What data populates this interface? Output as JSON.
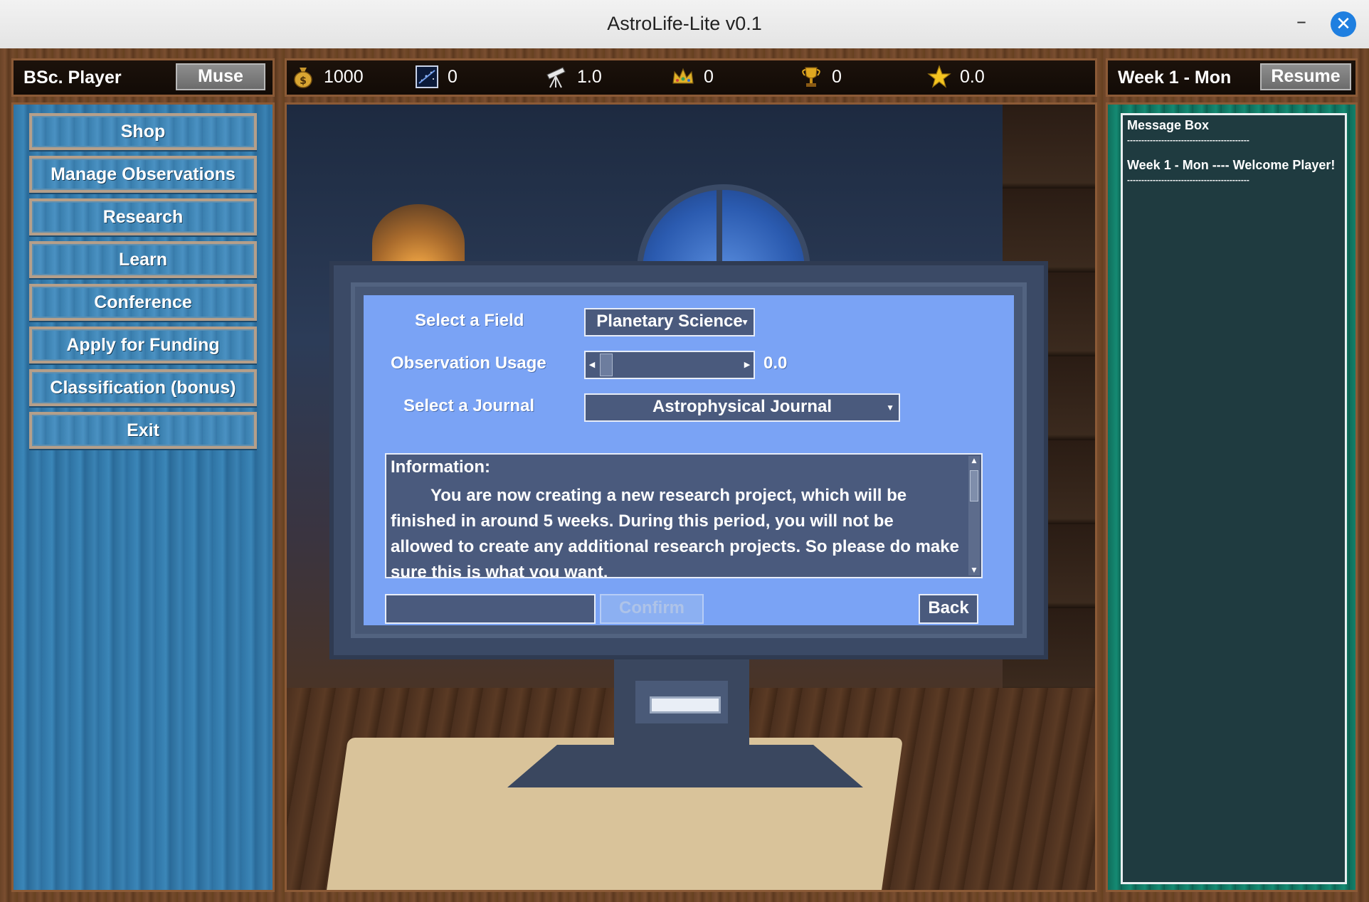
{
  "window": {
    "title": "AstroLife-Lite v0.1",
    "minimize": "–",
    "close": "✕"
  },
  "header": {
    "player": "BSc. Player",
    "muse_label": "Muse",
    "week": "Week 1 - Mon",
    "resume_label": "Resume"
  },
  "stats": {
    "money": "1000",
    "observations": "0",
    "telescope": "1.0",
    "crowns": "0",
    "trophies": "0",
    "stars": "0.0"
  },
  "menu": [
    "Shop",
    "Manage Observations",
    "Research",
    "Learn",
    "Conference",
    "Apply for Funding",
    "Classification (bonus)",
    "Exit"
  ],
  "form": {
    "field_label": "Select a Field",
    "field_value": "Planetary Science",
    "usage_label": "Observation Usage",
    "usage_value": "0.0",
    "usage_fraction": 0.0,
    "journal_label": "Select a Journal",
    "journal_value": "Astrophysical Journal",
    "info_title": "Information:",
    "info_text": "You are now creating a new research project, which will be finished in around 5 weeks. During this period, you will not be allowed to create any additional research  projects. So please do make sure this is what you want.",
    "input_value": "",
    "confirm_label": "Confirm",
    "back_label": "Back"
  },
  "messages": {
    "title": "Message Box",
    "separator": "-------------------------------------------",
    "entry": "Week 1 - Mon ---- Welcome Player!"
  },
  "colors": {
    "screen": "#7aa3f5",
    "menu_panel": "#3b86b8",
    "message_panel": "#158a72",
    "close_button": "#1f7fe0"
  }
}
